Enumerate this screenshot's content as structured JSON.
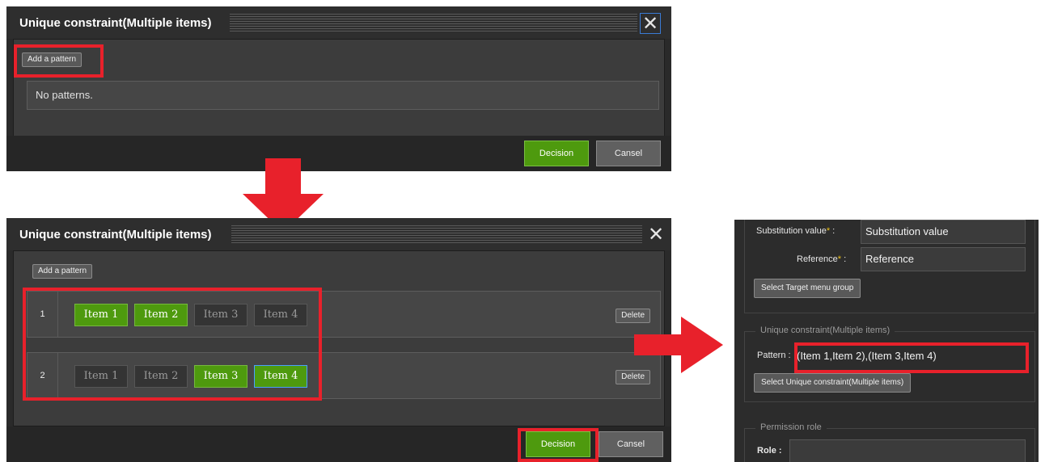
{
  "dialog_before": {
    "title": "Unique constraint(Multiple items)",
    "close_symbol": "✕",
    "add_pattern_label": "Add a pattern",
    "empty_message": "No patterns.",
    "decision_label": "Decision",
    "cancel_label": "Cansel"
  },
  "dialog_after": {
    "title": "Unique constraint(Multiple items)",
    "close_symbol": "✕",
    "add_pattern_label": "Add a pattern",
    "delete_label": "Delete",
    "decision_label": "Decision",
    "cancel_label": "Cansel",
    "patterns": [
      {
        "number": "1",
        "items": [
          {
            "label": "Item 1",
            "selected": true
          },
          {
            "label": "Item 2",
            "selected": true
          },
          {
            "label": "Item 3",
            "selected": false
          },
          {
            "label": "Item 4",
            "selected": false
          }
        ]
      },
      {
        "number": "2",
        "items": [
          {
            "label": "Item 1",
            "selected": false
          },
          {
            "label": "Item 2",
            "selected": false
          },
          {
            "label": "Item 3",
            "selected": true
          },
          {
            "label": "Item 4",
            "selected": true
          }
        ]
      }
    ]
  },
  "form_panel": {
    "substitution_label": "Substitution value",
    "substitution_suffix": " :",
    "substitution_value": "Substitution value",
    "reference_label": "Reference",
    "reference_suffix": " :",
    "reference_value": "Reference",
    "required_mark": "*",
    "select_target_menu_group_label": "Select Target menu group",
    "unique_section_legend": "Unique constraint(Multiple items)",
    "pattern_label": "Pattern :",
    "pattern_value": "(Item 1,Item 2),(Item 3,Item 4)",
    "select_unique_label": "Select Unique constraint(Multiple items)",
    "permission_section_legend": "Permission role",
    "role_label": "Role :"
  },
  "colors": {
    "arrow": "#e8212b",
    "highlight": "#e8212b",
    "selected_item": "#4e9a0e",
    "required_mark": "#f0c419"
  }
}
